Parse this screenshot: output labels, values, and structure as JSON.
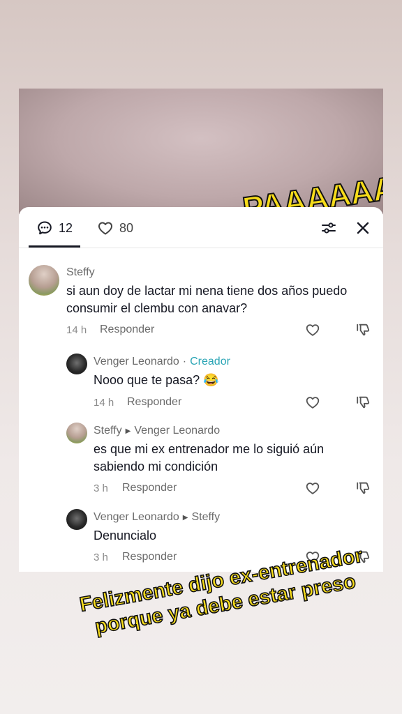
{
  "video": {
    "caption": "PAAAAAA"
  },
  "header": {
    "comments_count": "12",
    "likes_count": "80"
  },
  "comments": [
    {
      "author": "Steffy",
      "text": "si aun doy de lactar mi nena tiene dos años puedo consumir el clembu con anavar?",
      "time": "14 h",
      "reply_label": "Responder"
    },
    {
      "author": "Venger Leonardo",
      "separator": "·",
      "badge": "Creador",
      "text": "Nooo que te pasa? 😂",
      "time": "14 h",
      "reply_label": "Responder"
    },
    {
      "author": "Steffy",
      "reply_to": "Venger Leonardo",
      "text": "es que mi ex entrenador me lo siguió aún sabiendo mi condición",
      "time": "3 h",
      "reply_label": "Responder"
    },
    {
      "author": "Venger Leonardo",
      "reply_to": "Steffy",
      "text": "Denuncialo",
      "time": "3 h",
      "reply_label": "Responder"
    }
  ],
  "overlay_caption": "Felizmente dijo ex-entrenador porque ya debe estar preso"
}
